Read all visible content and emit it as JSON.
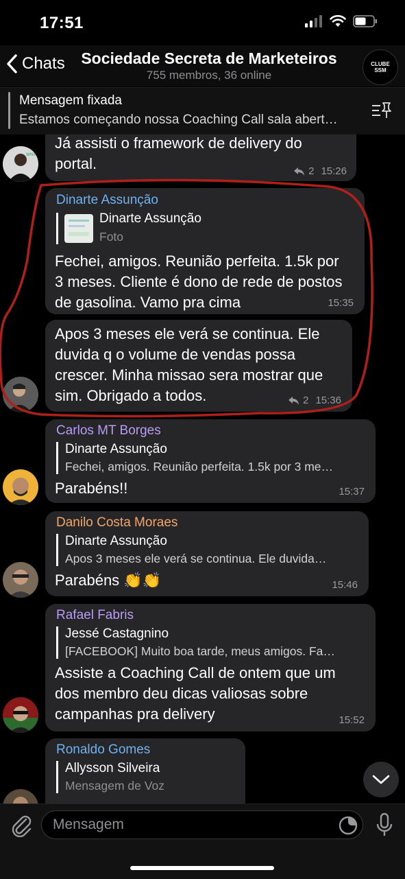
{
  "status_bar": {
    "time": "17:51"
  },
  "header": {
    "back_label": "Chats",
    "title": "Sociedade Secreta de Marketeiros",
    "subtitle": "755 membros, 36 online",
    "logo_line1": "CLUBE",
    "logo_line2": "SSM"
  },
  "pinned": {
    "title": "Mensagem fixada",
    "text": "Estamos começando nossa Coaching Call sala abert…"
  },
  "messages": {
    "m0": {
      "text": "Já assisti o framework de delivery do portal.",
      "replies": "2",
      "time": "15:26"
    },
    "m1": {
      "sender": "Dinarte Assunção",
      "reply_name": "Dinarte Assunção",
      "reply_text": "Foto",
      "text": "Fechei, amigos. Reunião perfeita. 1.5k por 3 meses. Cliente é dono de rede de postos de gasolina. Vamo pra cima",
      "time": "15:35"
    },
    "m2": {
      "text": "Apos 3 meses ele verá se continua. Ele duvida q o volume de vendas possa crescer. Minha missao sera mostrar que sim. Obrigado a todos.",
      "replies": "2",
      "time": "15:36"
    },
    "m3": {
      "sender": "Carlos MT Borges",
      "reply_name": "Dinarte Assunção",
      "reply_text": "Fechei, amigos. Reunião perfeita. 1.5k por 3 me…",
      "text": "Parabéns!!",
      "time": "15:37"
    },
    "m4": {
      "sender": "Danilo Costa Moraes",
      "reply_name": "Dinarte Assunção",
      "reply_text": "Apos 3 meses ele verá se continua. Ele duvida…",
      "text": "Parabéns 👏👏",
      "time": "15:46"
    },
    "m5": {
      "sender": "Rafael Fabris",
      "reply_name": "Jessé Castagnino",
      "reply_text": "[FACEBOOK] Muito boa tarde, meus amigos. Fa…",
      "text": "Assiste a Coaching Call de ontem que um dos membro deu dicas valiosas sobre campanhas pra delivery",
      "time": "15:52"
    },
    "m6": {
      "sender": "Ronaldo Gomes",
      "reply_name": "Allysson Silveira",
      "reply_text": "Mensagem de Voz"
    }
  },
  "input": {
    "placeholder": "Mensagem"
  },
  "colors": {
    "background": "#000000",
    "bubble": "#262628",
    "sender_blue": "#6fb2f2",
    "sender_purple": "#b89cf5",
    "sender_orange": "#f4a56a",
    "annotation_red": "#b0201a"
  }
}
